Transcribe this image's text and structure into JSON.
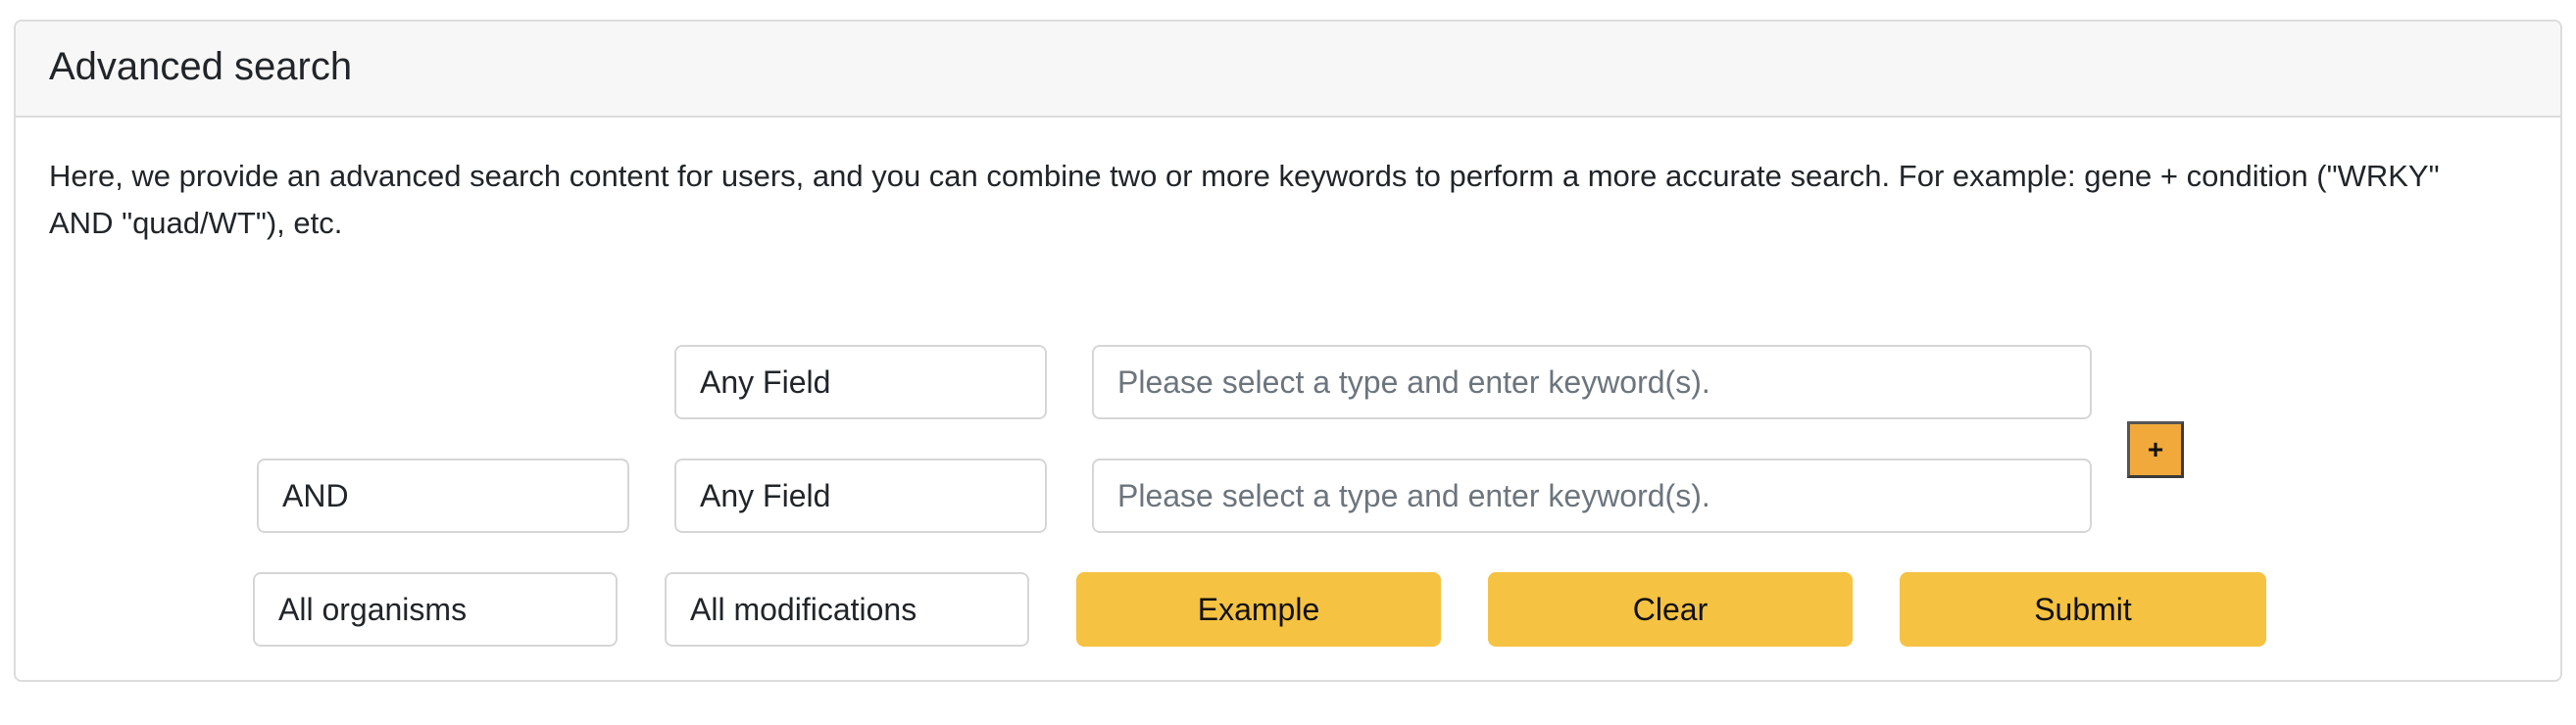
{
  "header": {
    "title": "Advanced search"
  },
  "description": "Here, we provide an advanced search content for users, and you can combine two or more keywords to perform a more accurate search. For example: gene + condition (\"WRKY\" AND \"quad/WT\"), etc.",
  "rows": [
    {
      "field_select": "Any Field",
      "keyword_placeholder": "Please select a type and enter keyword(s)."
    },
    {
      "operator": "AND",
      "field_select": "Any Field",
      "keyword_placeholder": "Please select a type and enter keyword(s)."
    }
  ],
  "add_row_label": "+",
  "filters": {
    "organism": "All organisms",
    "modification": "All modifications"
  },
  "actions": {
    "example_label": "Example",
    "clear_label": "Clear",
    "submit_label": "Submit"
  },
  "colors": {
    "button": "#f5c242",
    "add_button": "#f0a93a",
    "header_bg": "#f7f7f7",
    "border": "#dcdcdc"
  }
}
